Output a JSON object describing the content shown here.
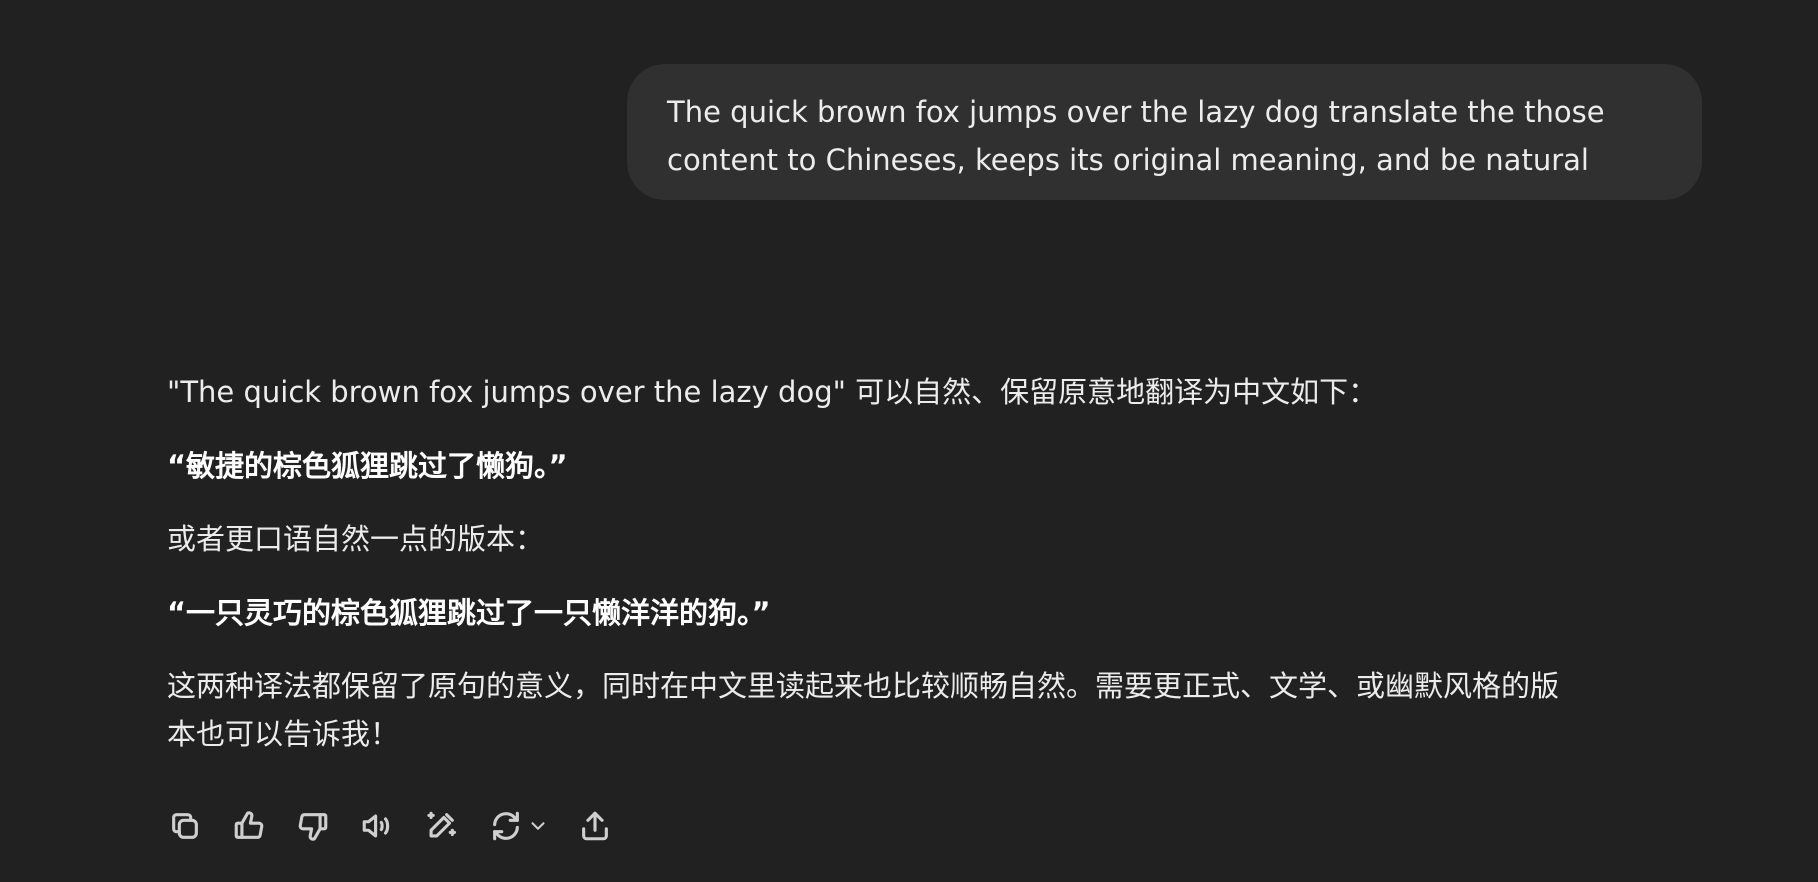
{
  "user_message": {
    "line1": "The quick brown fox jumps over the lazy dog translate the those",
    "line2": "content to Chineses, keeps its original meaning, and be natural"
  },
  "assistant_message": {
    "paragraphs": [
      "\"The quick brown fox jumps over the lazy dog\" 可以自然、保留原意地翻译为中文如下：",
      "“敏捷的棕色狐狸跳过了懒狗。”",
      "或者更口语自然一点的版本：",
      "“一只灵巧的棕色狐狸跳过了一只懒洋洋的狗。”",
      "这两种译法都保留了原句的意义，同时在中文里读起来也比较顺畅自然。需要更正式、文学、或幽默风格的版",
      "本也可以告诉我！"
    ]
  },
  "action_icons": [
    "copy-icon",
    "thumbs-up-icon",
    "thumbs-down-icon",
    "read-aloud-icon",
    "edit-icon",
    "regenerate-icon",
    "share-icon"
  ],
  "colors": {
    "background": "#212121",
    "user_bubble": "#303030",
    "text": "#ececec",
    "icon": "#cfcfcf"
  }
}
